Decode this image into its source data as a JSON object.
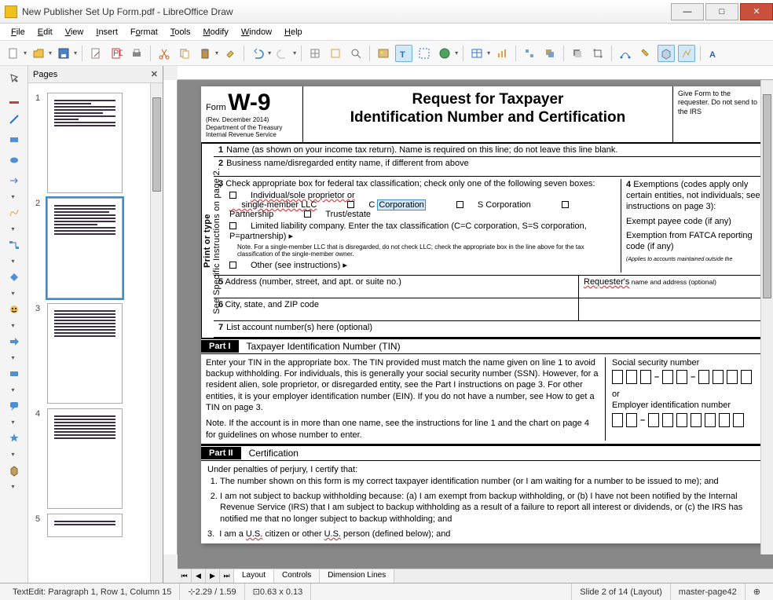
{
  "window": {
    "title": "New Publisher Set Up Form.pdf - LibreOffice Draw"
  },
  "menu": [
    "File",
    "Edit",
    "View",
    "Insert",
    "Format",
    "Tools",
    "Modify",
    "Window",
    "Help"
  ],
  "pages_panel": {
    "title": "Pages",
    "selected": 2,
    "count": 5
  },
  "tabs": {
    "items": [
      "Layout",
      "Controls",
      "Dimension Lines"
    ],
    "active": 0
  },
  "status": {
    "edit": "TextEdit: Paragraph 1, Row 1, Column 15",
    "pos": "2.29 / 1.59",
    "size": "0.63 x 0.13",
    "slide": "Slide 2 of 14 (Layout)",
    "master": "master-page42"
  },
  "w9": {
    "form_label": "Form",
    "form_name": "W-9",
    "rev": "(Rev. December 2014)",
    "dept": "Department of the Treasury",
    "irs": "Internal Revenue Service",
    "title1": "Request for Taxpayer",
    "title2": "Identification Number and Certification",
    "give": "Give Form to the requester. Do not send to the IRS",
    "side_top": "Print or type",
    "side_bot": "See Specific Instructions on page 2.",
    "line1": "Name (as shown on your income tax return). Name is required on this line; do not leave this line blank.",
    "line2": "Business name/disregarded entity name, if different from above",
    "line3": "Check appropriate box for federal tax classification; check only one of the following seven boxes:",
    "cb": {
      "ind": "Individual/sole proprietor or single-member LLC",
      "ccorp": "C Corporation",
      "scorp": "S Corporation",
      "part": "Partnership",
      "trust": "Trust/estate",
      "llc": "Limited liability company. Enter the tax classification (C=C corporation, S=S corporation, P=partnership)  ▸",
      "note": "Note. For a single-member LLC that is disregarded, do not check LLC; check the appropriate box in the line above for the tax classification of the single-member owner.",
      "other": "Other (see instructions) ▸"
    },
    "box4": {
      "hdr": "Exemptions (codes apply only certain entities, not individuals; see instructions on page 3):",
      "a": "Exempt payee code (if any)",
      "b": "Exemption from FATCA reporting code (if any)",
      "c": "(Applies to accounts maintained outside the"
    },
    "line5": "Address (number, street, and apt. or suite no.)",
    "line5r": "Requester's name and address (optional)",
    "line6": "City, state, and ZIP code",
    "line7": "List account number(s) here (optional)",
    "part1": {
      "hdr": "Part I",
      "lbl": "Taxpayer Identification Number (TIN)",
      "txt": "Enter your TIN in the appropriate box. The TIN provided must match the name given on line 1 to avoid backup withholding. For individuals, this is generally your social security number (SSN). However, for a resident alien, sole proprietor, or disregarded entity, see the Part I instructions on page 3. For other entities, it is your employer identification number (EIN). If you do not have a number, see How to get a TIN on page 3.",
      "note": "Note. If the account is in more than one name, see the instructions for line 1 and the chart on page 4 for guidelines on whose number to enter.",
      "ssn": "Social security number",
      "or": "or",
      "ein": "Employer identification number"
    },
    "part2": {
      "hdr": "Part II",
      "lbl": "Certification",
      "intro": "Under penalties of perjury, I certify that:",
      "i1": "The number shown on this form is my correct taxpayer identification number (or I am waiting for a number to be issued to me); and",
      "i2": "I am not subject to backup withholding because: (a) I am exempt from backup withholding, or (b) I have not been notified by the Internal Revenue Service (IRS) that I am subject to backup withholding as a result of a failure to report all interest or dividends, or (c) the IRS has notified me that no longer subject to backup withholding; and",
      "i3": "I am a U.S. citizen or other U.S. person (defined below); and"
    }
  }
}
